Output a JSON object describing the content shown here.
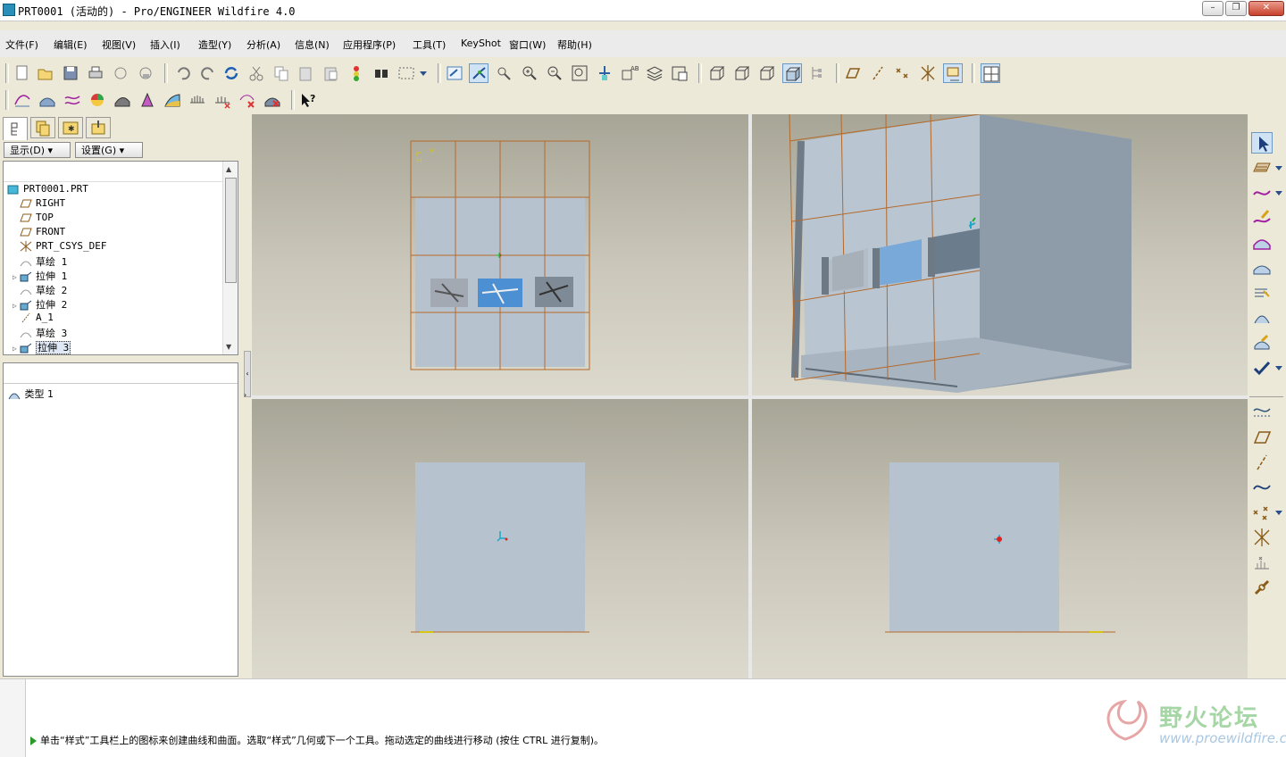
{
  "window": {
    "title": "PRT0001 (活动的) - Pro/ENGINEER Wildfire 4.0",
    "buttons": [
      "minimize",
      "restore",
      "close"
    ]
  },
  "menubar": {
    "items": [
      "文件(F)",
      "编辑(E)",
      "视图(V)",
      "插入(I)",
      "造型(Y)",
      "分析(A)",
      "信息(N)",
      "应用程序(P)",
      "工具(T)",
      "KeyShot",
      "窗口(W)",
      "帮助(H)"
    ]
  },
  "toolbar1": {
    "icons": [
      "new-icon",
      "open-icon",
      "save-icon",
      "print-icon",
      "send-mail-icon",
      "send-mail-attach-icon",
      "undo-icon",
      "redo-icon",
      "regenerate-icon",
      "cut-icon",
      "copy-icon",
      "paste-icon",
      "paste-special-icon",
      "traffic-light-icon",
      "find-icon",
      "select-box-icon",
      "select-dropdown-icon",
      "repaint-icon",
      "spin-center-icon",
      "orient-mode-icon",
      "zoom-in-icon",
      "zoom-out-icon",
      "refit-icon",
      "reorient-icon",
      "saved-views-icon",
      "layers-icon",
      "view-manager-icon",
      "wireframe-icon",
      "hidden-line-icon",
      "no-hidden-icon",
      "shading-icon",
      "model-tree-display-icon",
      "datum-planes-icon",
      "datum-axes-icon",
      "datum-points-icon",
      "csys-icon",
      "annotations-icon",
      "multi-viewport-icon"
    ]
  },
  "toolbar2": {
    "icons": [
      "curve-icon",
      "surface-icon",
      "curve-on-surface-icon",
      "reflection-analysis-icon",
      "shade-analysis-icon",
      "draft-analysis-icon",
      "slope-analysis-icon",
      "curvature-analysis-icon",
      "section-analysis-icon",
      "delete-analysis-icon",
      "delete-all-analysis-icon",
      "context-help-icon"
    ]
  },
  "leftpanel": {
    "tabs": [
      "model-tree-tab",
      "layers-tab",
      "favorites-tab",
      "settings-tab"
    ],
    "display_button": "显示(D)",
    "settings_button": "设置(G)",
    "tree_items": [
      {
        "label": "PRT0001.PRT",
        "icon": "part-icon",
        "expandable": false,
        "indent": 0
      },
      {
        "label": "RIGHT",
        "icon": "datum-plane-icon",
        "expandable": false,
        "indent": 1
      },
      {
        "label": "TOP",
        "icon": "datum-plane-icon",
        "expandable": false,
        "indent": 1
      },
      {
        "label": "FRONT",
        "icon": "datum-plane-icon",
        "expandable": false,
        "indent": 1
      },
      {
        "label": "PRT_CSYS_DEF",
        "icon": "csys-icon",
        "expandable": false,
        "indent": 1
      },
      {
        "label": "草绘 1",
        "icon": "sketch-icon",
        "expandable": false,
        "indent": 1
      },
      {
        "label": "拉伸 1",
        "icon": "extrude-icon",
        "expandable": true,
        "indent": 1
      },
      {
        "label": "草绘 2",
        "icon": "sketch-icon",
        "expandable": false,
        "indent": 1
      },
      {
        "label": "拉伸 2",
        "icon": "extrude-icon",
        "expandable": true,
        "indent": 1
      },
      {
        "label": "A_1",
        "icon": "axis-icon",
        "expandable": false,
        "indent": 1
      },
      {
        "label": "草绘 3",
        "icon": "sketch-icon",
        "expandable": false,
        "indent": 1
      },
      {
        "label": "拉伸 3",
        "icon": "extrude-icon",
        "expandable": true,
        "indent": 1,
        "selected": true
      }
    ],
    "style_tree_item": "类型 1"
  },
  "viewports": {
    "top_left_axis_label": "H",
    "top_left_axis_label2": "V"
  },
  "rightbar": {
    "icons": [
      "select-arrow-icon",
      "set-active-plane-icon",
      "create-curve-icon",
      "edit-curve-icon",
      "boundary-surface-icon",
      "trim-surface-icon",
      "surface-edit-icon",
      "connect-icon",
      "curve-analysis-icon",
      "done-check-icon",
      "curve-from-datum-icon",
      "datum-plane-icon",
      "datum-axis-icon",
      "datum-curve-icon",
      "datum-point-icon",
      "datum-csys-icon",
      "analysis-feature-icon",
      "chain-link-icon"
    ]
  },
  "status": {
    "message": "单击“样式”工具栏上的图标来创建曲线和曲面。选取“样式”几何或下一个工具。拖动选定的曲线进行移动 (按住 CTRL 进行复制)。"
  },
  "watermark": {
    "title": "野火论坛",
    "url": "www.proewildfire.cn"
  }
}
